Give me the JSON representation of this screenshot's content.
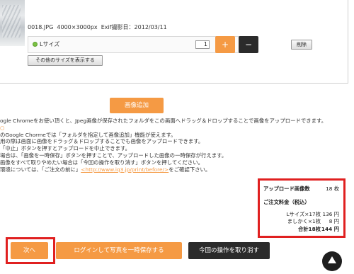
{
  "item": {
    "filename": "0018.JPG",
    "dimensions": "4000×3000px",
    "exif_label": "Exif撮影日：2012/03/11",
    "size_label": "Lサイズ",
    "quantity": "1",
    "plus": "+",
    "minus": "−",
    "delete_label": "削除",
    "other_sizes_label": "その他のサイズを表示する"
  },
  "add_image_label": "画像追加",
  "instructions": [
    "ogle Chromeをお使い頂くと、Jpeg画像が保存されたフォルダをこの画面へドラッグ＆ドロップすることで画像をアップロードできます。",
    "のGoogle Chormeでは「フォルダを指定して画像追加」機能が使えます。",
    "用の際は画面に画像をドラッグ＆ドロップすることでも画像をアップロードできます。",
    "「中止」ボタンを押すとアップロードを中止できます。",
    "場合は、「画像を一時保存」ボタンを押すことで、アップロードした画像の一時保存が行えます。",
    "画像をすべて取りやめたい場合は「今回の操作を取り消す」ボタンを押してください。",
    "環境については、「ご注文の前に」",
    "<http://www.iq3.jp/print/before/>",
    "をご確認下さい。"
  ],
  "summary": {
    "uploaded_label": "アップロード画像数",
    "uploaded_value": "18 枚",
    "fee_label": "ご注文料金（税込）",
    "lines": [
      {
        "label": "Lサイズ×17枚",
        "value": "136 円"
      },
      {
        "label": "ましかく×1枚",
        "value": "8 円"
      }
    ],
    "total_label": "合計18枚",
    "total_value": "144 円"
  },
  "actions": {
    "next": "次へ",
    "login_save": "ログインして写真を一時保存する",
    "cancel_op": "今回の操作を取り消す"
  },
  "colors": {
    "accent": "#f59a44",
    "dark": "#2b2b2b",
    "highlight": "#e02020"
  }
}
